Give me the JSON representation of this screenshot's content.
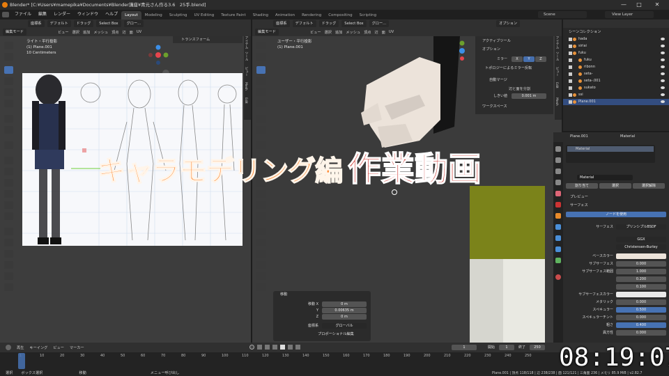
{
  "window": {
    "title": "Blender* [C:¥Users¥mamepika¥Documents¥Blender講座¥青元さん作る3.6　25手.blend]",
    "minimize": "—",
    "maximize": "□",
    "close": "✕"
  },
  "menubar": {
    "items": [
      "ファイル",
      "編集",
      "レンダー",
      "ウィンドウ",
      "ヘルプ"
    ],
    "workspaces": [
      "Layout",
      "Modeling",
      "Sculpting",
      "UV Editing",
      "Texture Paint",
      "Shading",
      "Animation",
      "Rendering",
      "Compositing",
      "Scripting"
    ],
    "active_workspace": "Layout",
    "scene": "Scene",
    "view_layer": "View Layer"
  },
  "left_view": {
    "header": {
      "mode": "編集モード",
      "menus": [
        "ビュー",
        "選択",
        "追加",
        "メッシュ",
        "頂点",
        "辺",
        "面",
        "UV"
      ],
      "orientation": "座標系",
      "pivot": "デフォルト",
      "drag": "ドラッグ",
      "select_box": "Select Box",
      "snap": "グロー..."
    },
    "overlay_lines": [
      "ライト・平行投影",
      "(1) Plane.001",
      "10 Centimeters"
    ],
    "sidebar_panel": "トランスフォーム",
    "sidebar_tabs": [
      "アイテム",
      "ツール",
      "ビュー",
      "Mesh",
      "Edit"
    ]
  },
  "right_view": {
    "header": {
      "mode": "編集モード",
      "menus": [
        "ビュー",
        "選択",
        "追加",
        "メッシュ",
        "頂点",
        "辺",
        "面",
        "UV"
      ],
      "orientation": "座標系",
      "pivot": "デフォルト",
      "drag": "ドラッグ",
      "select_box": "Select Box",
      "snap": "グロー...",
      "options": "オプション"
    },
    "overlay_lines": [
      "ユーザー・平行投影",
      "(1) Plane.001"
    ],
    "tool_panel": {
      "active_tool": "アクティブツール",
      "options": "オプション",
      "mirror_label": "ミラー",
      "axes": [
        "X",
        "Y",
        "Z"
      ],
      "topology_mirror": "トポロジーによるミラー反転",
      "auto_merge": "自動マージ",
      "split_edges": "辺と面を分割",
      "threshold_label": "しきい値",
      "threshold_value": "0.001 m",
      "workspace": "ワークスペース"
    },
    "sidebar_tabs": [
      "アイテム",
      "ツール",
      "ビュー",
      "Edit",
      "Mesh"
    ],
    "operator_panel": {
      "title": "移動",
      "rows": [
        {
          "label": "移動 X",
          "value": "0 m"
        },
        {
          "label": "Y",
          "value": "0.00635 m"
        },
        {
          "label": "Z",
          "value": "0 m"
        }
      ],
      "orientation_label": "座標系",
      "orientation_value": "グローバル",
      "proportional": "プロポーショナル編集"
    }
  },
  "overlay_caption": {
    "part1": "キャラモデリング編",
    "part2": "作業動画"
  },
  "clock": "08:19:07",
  "outliner": {
    "title": "シーンコレクション",
    "items": [
      "hada",
      "siriai",
      "fuku",
      "fuku",
      "ribonn",
      "seta-",
      "seta-.001",
      "sukato",
      "ssi",
      "Plane.001"
    ],
    "selected": "Plane.001"
  },
  "properties": {
    "object": "Plane.001",
    "material_tab": "Material",
    "slot": "Material",
    "material_name": "Material",
    "buttons": [
      "割り当て",
      "選択",
      "選択解除"
    ],
    "preview": "プレビュー",
    "surface": "サーフェス",
    "use_nodes": "ノードを使用",
    "surface_label": "サーフェス",
    "surface_value": "プリンシプルBSDF",
    "distribution": "GGX",
    "subsurface_method": "Christensen-Burley",
    "rows": [
      {
        "label": "ベースカラー",
        "value": "",
        "kind": "color"
      },
      {
        "label": "サブサーフェス",
        "value": "0.000",
        "kind": "num"
      },
      {
        "label": "サブサーフェス範囲",
        "value": "1.000",
        "kind": "num"
      },
      {
        "label": "",
        "value": "0.200",
        "kind": "num"
      },
      {
        "label": "",
        "value": "0.100",
        "kind": "num"
      },
      {
        "label": "サブサーフェスカラー",
        "value": "",
        "kind": "color"
      },
      {
        "label": "メタリック",
        "value": "0.000",
        "kind": "num"
      },
      {
        "label": "スペキュラー",
        "value": "0.500",
        "kind": "blue"
      },
      {
        "label": "スペキュラーチント",
        "value": "0.000",
        "kind": "num"
      },
      {
        "label": "粗さ",
        "value": "0.400",
        "kind": "blue"
      },
      {
        "label": "異方性",
        "value": "0.000",
        "kind": "num"
      }
    ]
  },
  "timeline": {
    "menus": [
      "再生",
      "キーイング",
      "ビュー",
      "マーカー"
    ],
    "current_frame": "1",
    "start_label": "開始",
    "start": "1",
    "end_label": "終了",
    "end": "250",
    "ticks": [
      "1",
      "10",
      "20",
      "30",
      "40",
      "50",
      "60",
      "70",
      "80",
      "90",
      "100",
      "110",
      "120",
      "130",
      "140",
      "150",
      "160",
      "170",
      "180",
      "190",
      "200",
      "210",
      "220",
      "230",
      "240",
      "250"
    ]
  },
  "statusbar": {
    "left": [
      "選択",
      "ボックス選択",
      "移動",
      "メニュー呼び出し"
    ],
    "right": "Plane.001 | 頂点 118/118 | 辺 238/238 | 面 121/121 | 三角面 236 | メモリ 85.9 MiB | v2.82.7"
  },
  "colors": {
    "accent": "#4772b3",
    "caption_orange": "#ff7a1a",
    "caption_red": "#c8221b",
    "skin": "#ece3da"
  }
}
